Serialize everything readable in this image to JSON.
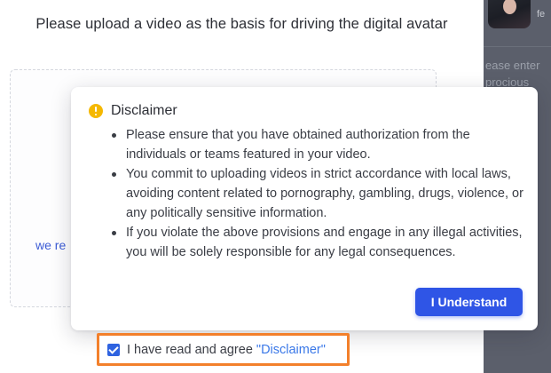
{
  "upload": {
    "title": "Please upload a video as the basis for driving the digital avatar",
    "dropzone_hint_fragment": "we re"
  },
  "right_pane": {
    "name_fragment": "fe",
    "placeholder_fragment": "ease enter\nprocious"
  },
  "disclaimer": {
    "title": "Disclaimer",
    "items": [
      "Please ensure that you have obtained authorization from the individuals or teams featured in your video.",
      "You commit to uploading videos in strict accordance with local laws, avoiding content related to pornography, gambling, drugs, violence, or any politically sensitive information.",
      "If you violate the above provisions and engage in any illegal activities, you will be solely responsible for any legal consequences."
    ],
    "confirm_label": "I Understand"
  },
  "agreement": {
    "checked": true,
    "text": "I have read and agree ",
    "link_text": "\"Disclaimer\""
  },
  "colors": {
    "primary": "#2f55e6",
    "link": "#3a78e8",
    "highlight_border": "#f3802b",
    "warning": "#f5b800",
    "right_pane_bg": "#5b5f6b"
  },
  "icons": {
    "warning": "warning-circle-icon",
    "checkbox": "check-icon"
  }
}
